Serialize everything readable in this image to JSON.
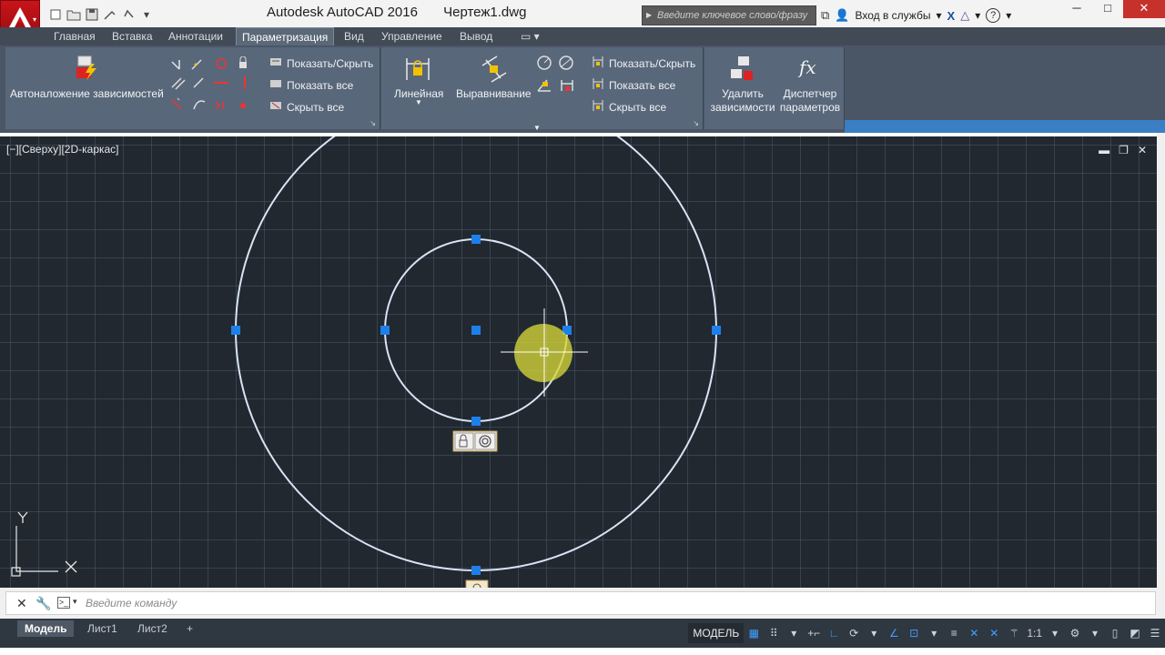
{
  "window": {
    "app_title": "Autodesk AutoCAD 2016",
    "file_name": "Чертеж1.dwg",
    "search_placeholder": "Введите ключевое слово/фразу",
    "sign_in": "Вход в службы",
    "controls": {
      "minimize": "─",
      "maximize": "□",
      "close": "✕"
    }
  },
  "qat": {
    "icons": [
      "new-file-icon",
      "open-file-icon",
      "save-icon",
      "saveas-icon",
      "undo-icon",
      "dropdown-arrow-icon"
    ]
  },
  "ribbon_tabs": [
    "Главная",
    "Вставка",
    "Аннотации",
    "Параметризация",
    "Вид",
    "Управление",
    "Вывод"
  ],
  "active_tab": "Параметризация",
  "ribbon": {
    "geometric": {
      "auto_constrain": "Автоналожение зависимостей",
      "show_hide": "Показать/Скрыть",
      "show_all": "Показать все",
      "hide_all": "Скрыть все"
    },
    "dimensional": {
      "linear": "Линейная",
      "aligned": "Выравнивание",
      "show_hide": "Показать/Скрыть",
      "show_all": "Показать все",
      "hide_all": "Скрыть все"
    },
    "manage": {
      "delete_constraints_1": "Удалить",
      "delete_constraints_2": "зависимости",
      "param_manager_1": "Диспетчер",
      "param_manager_2": "параметров",
      "fx_symbol": "fx"
    }
  },
  "viewport": {
    "label": "[−][Сверху][2D-каркас]",
    "ctrl_min": "▬",
    "ctrl_restore": "❐",
    "ctrl_close": "✕",
    "ucs_x": "X",
    "ucs_y": "Y"
  },
  "command_line": {
    "placeholder": "Введите команду"
  },
  "layout_tabs": [
    "Модель",
    "Лист1",
    "Лист2"
  ],
  "add_layout": "+",
  "status_bar": {
    "model": "МОДЕЛЬ",
    "scale": "1:1"
  },
  "colors": {
    "canvas_bg": "#212830",
    "circle_stroke": "#d8e4f5",
    "grip": "#1e7fe8",
    "cursor_highlight": "#d6d63a",
    "ribbon_panel": "#59677a"
  }
}
